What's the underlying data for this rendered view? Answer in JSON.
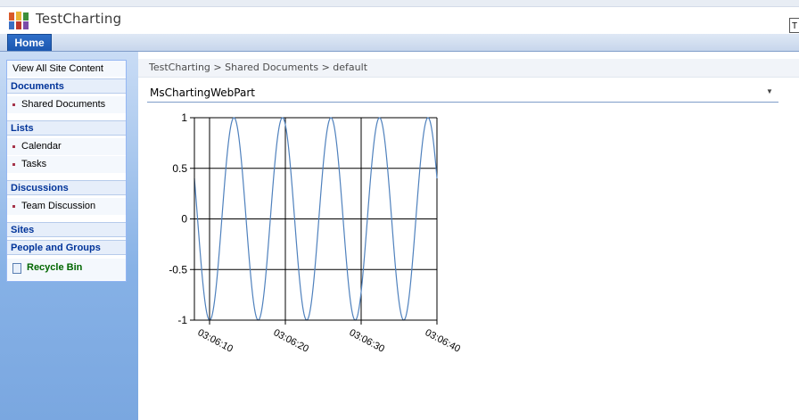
{
  "site": {
    "title": "TestCharting",
    "corner_letter": "T"
  },
  "topnav": {
    "tabs": [
      {
        "label": "Home"
      }
    ]
  },
  "quicklaunch": {
    "view_all": "View All Site Content",
    "sections": [
      {
        "heading": "Documents",
        "items": [
          "Shared Documents"
        ]
      },
      {
        "heading": "Lists",
        "items": [
          "Calendar",
          "Tasks"
        ]
      },
      {
        "heading": "Discussions",
        "items": [
          "Team Discussion"
        ]
      },
      {
        "heading": "Sites",
        "items": []
      },
      {
        "heading": "People and Groups",
        "items": []
      }
    ],
    "recycle_bin": "Recycle Bin"
  },
  "breadcrumb": {
    "items": [
      "TestCharting",
      "Shared Documents",
      "default"
    ],
    "separator": ">"
  },
  "webpart": {
    "title": "MsChartingWebPart",
    "menu_glyph": "▼"
  },
  "colors": {
    "line": "#4f81bd",
    "accent": "#1b57b0",
    "ql_link": "#003399",
    "recycle": "#006600"
  },
  "chart_data": {
    "type": "line",
    "title": "",
    "xlabel": "",
    "ylabel": "",
    "ylim": [
      -1,
      1
    ],
    "y_ticks": [
      "1",
      "0.5",
      "0",
      "-0.5",
      "-1"
    ],
    "x_ticks": [
      "03:06:10",
      "03:06:20",
      "03:06:30",
      "03:06:40"
    ],
    "x_range_seconds": [
      "03:06:08",
      "03:06:40"
    ],
    "grid": true,
    "series": [
      {
        "name": "",
        "description": "sine wave sampled over time",
        "start_time": "03:06:08",
        "end_time": "03:06:40",
        "amplitude": 1,
        "period_seconds": 6.4,
        "start_value": 0.4
      }
    ]
  }
}
